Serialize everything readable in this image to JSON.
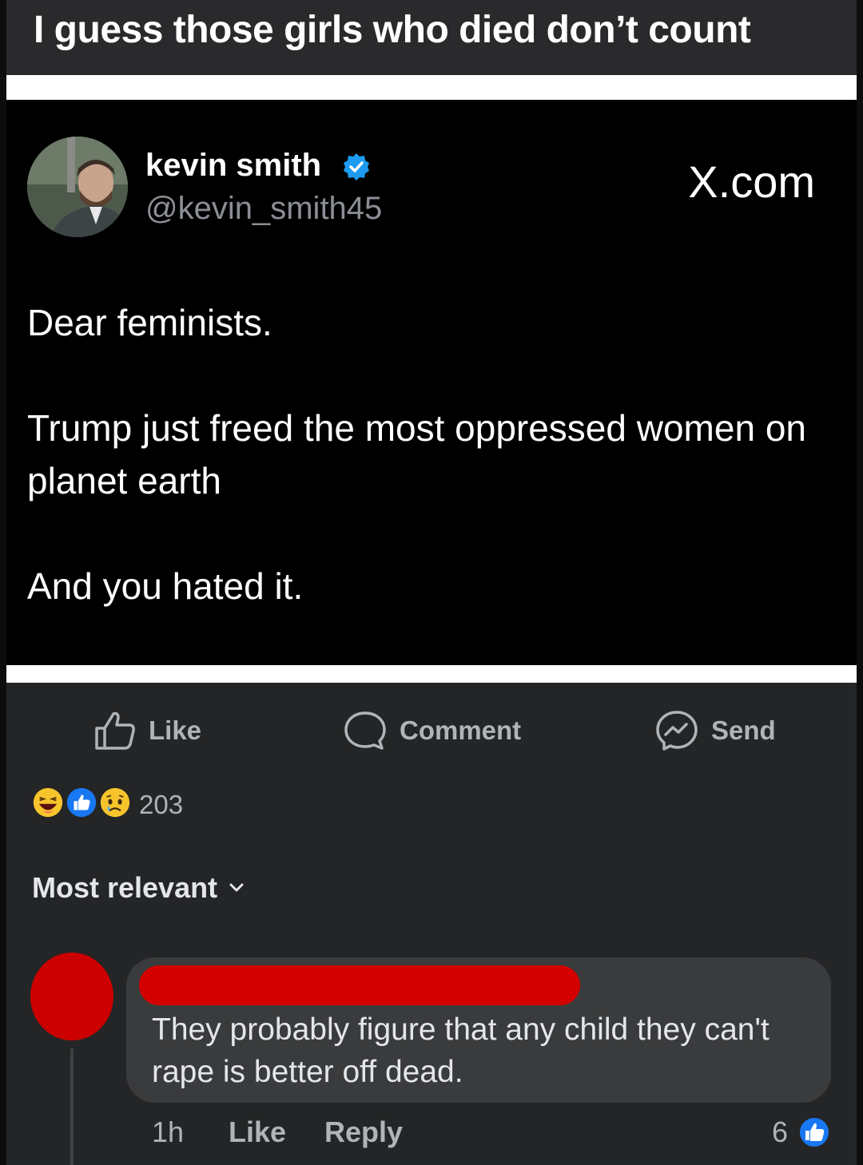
{
  "caption": {
    "text": "I guess those girls who died don’t count"
  },
  "tweet": {
    "author_name": "kevin smith",
    "author_handle": "@kevin_smith45",
    "source": "X.com",
    "paragraphs": [
      "Dear feminists.",
      "Trump just freed the most oppressed women on planet earth",
      "And you hated it."
    ]
  },
  "actions": {
    "like": "Like",
    "comment": "Comment",
    "send": "Send"
  },
  "reactions": {
    "count": "203",
    "types": [
      "haha",
      "like",
      "sad"
    ]
  },
  "sort": {
    "label": "Most relevant"
  },
  "comment": {
    "text": "They probably figure that any child they can't rape is better off dead.",
    "time": "1h",
    "like_label": "Like",
    "reply_label": "Reply",
    "reaction_count": "6"
  },
  "colors": {
    "fb_bg": "#242526",
    "accent_blue": "#1877f2",
    "redaction": "#d40000",
    "verified": "#1d9bf0"
  }
}
